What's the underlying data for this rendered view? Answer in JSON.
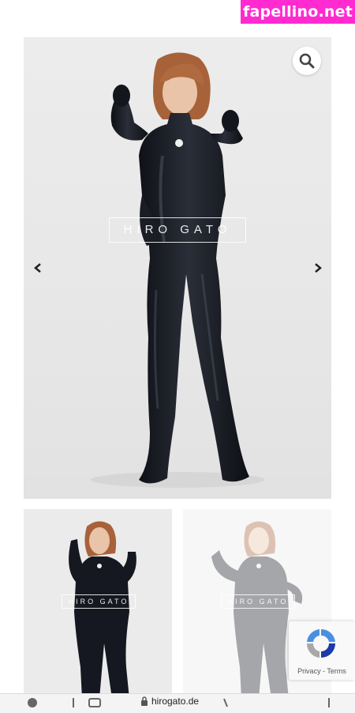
{
  "watermark": {
    "text": "fapellino.net",
    "color": "#ff2ad0"
  },
  "gallery": {
    "brand_text": "HIRO GATO",
    "zoom_icon": "search-icon",
    "prev_icon": "chevron-left-icon",
    "next_icon": "chevron-right-icon"
  },
  "thumbnails": [
    {
      "brand_text": "HIRO GATO"
    },
    {
      "brand_text": "HIRO GATO"
    }
  ],
  "recaptcha": {
    "privacy": "Privacy",
    "separator": " - ",
    "terms": "Terms"
  },
  "browser": {
    "url": "hirogato.de",
    "lock_icon": "lock-icon"
  },
  "colors": {
    "suit": "#151820",
    "hair": "#a8623a",
    "background": "#e8e8e8"
  }
}
